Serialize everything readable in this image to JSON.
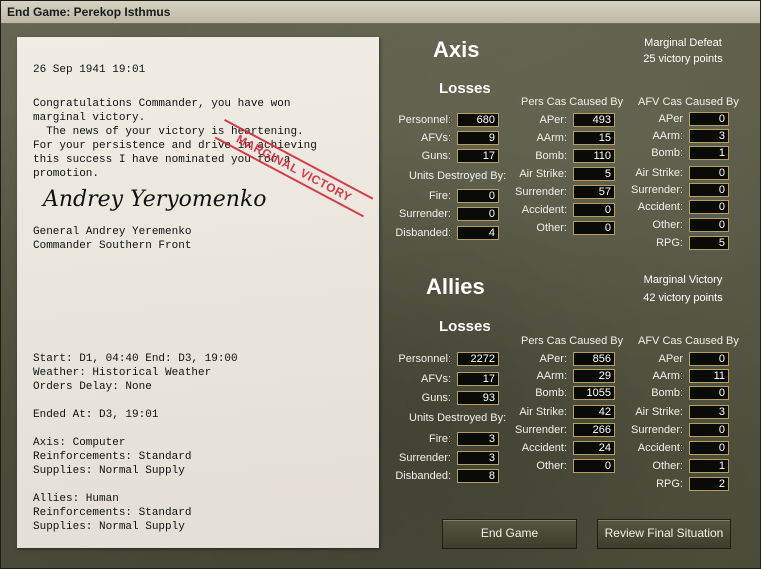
{
  "window": {
    "title": "End Game: Perekop Isthmus"
  },
  "letter": {
    "date": "26 Sep 1941 19:01",
    "stamp": "MARGINAL VICTORY",
    "body": [
      "Congratulations Commander, you have won",
      "marginal victory.",
      "  The news of your victory is heartening.",
      "For your persistence and drive in achieving",
      "this success I have nominated you for a",
      "promotion."
    ],
    "signature": "Andrey Yeryomenko",
    "signer_name": "General Andrey Yeremenko",
    "signer_title": "Commander Southern Front",
    "info": [
      "Start: D1, 04:40 End: D3, 19:00",
      "Weather: Historical Weather",
      "Orders Delay: None",
      "",
      "Ended At: D3, 19:01",
      "",
      "Axis: Computer",
      "Reinforcements: Standard",
      "Supplies: Normal Supply",
      "",
      "Allies: Human",
      "Reinforcements: Standard",
      "Supplies: Normal Supply"
    ]
  },
  "headers": {
    "losses": "Losses",
    "units_destroyed": "Units Destroyed By:",
    "pers_cas": "Pers Cas Caused By",
    "afv_cas": "AFV Cas Caused By"
  },
  "labels": {
    "personnel": "Personnel:",
    "afvs": "AFVs:",
    "guns": "Guns:",
    "fire": "Fire:",
    "surrender": "Surrender:",
    "disbanded": "Disbanded:",
    "aper": "APer:",
    "aarm": "AArm:",
    "bomb": "Bomb:",
    "air_strike": "Air Strike:",
    "accident": "Accident:",
    "other": "Other:",
    "rpg": "RPG:",
    "aper_nocolon": "APer"
  },
  "axis": {
    "name": "Axis",
    "verdict": "Marginal Defeat",
    "points": "25 victory points",
    "losses": {
      "personnel": "680",
      "afvs": "9",
      "guns": "17"
    },
    "destroyed": {
      "fire": "0",
      "surrender": "0",
      "disbanded": "4"
    },
    "pers": {
      "aper": "493",
      "aarm": "15",
      "bomb": "110",
      "air_strike": "5",
      "surrender": "57",
      "accident": "0",
      "other": "0"
    },
    "afv": {
      "aper": "0",
      "aarm": "3",
      "bomb": "1",
      "air_strike": "0",
      "surrender": "0",
      "accident": "0",
      "other": "0",
      "rpg": "5"
    }
  },
  "allies": {
    "name": "Allies",
    "verdict": "Marginal Victory",
    "points": "42 victory points",
    "losses": {
      "personnel": "2272",
      "afvs": "17",
      "guns": "93"
    },
    "destroyed": {
      "fire": "3",
      "surrender": "3",
      "disbanded": "8"
    },
    "pers": {
      "aper": "856",
      "aarm": "29",
      "bomb": "1055",
      "air_strike": "42",
      "surrender": "266",
      "accident": "24",
      "other": "0"
    },
    "afv": {
      "aper": "0",
      "aarm": "11",
      "bomb": "0",
      "air_strike": "3",
      "surrender": "0",
      "accident": "0",
      "other": "1",
      "rpg": "2"
    }
  },
  "buttons": {
    "end_game": "End Game",
    "review": "Review Final Situation"
  }
}
